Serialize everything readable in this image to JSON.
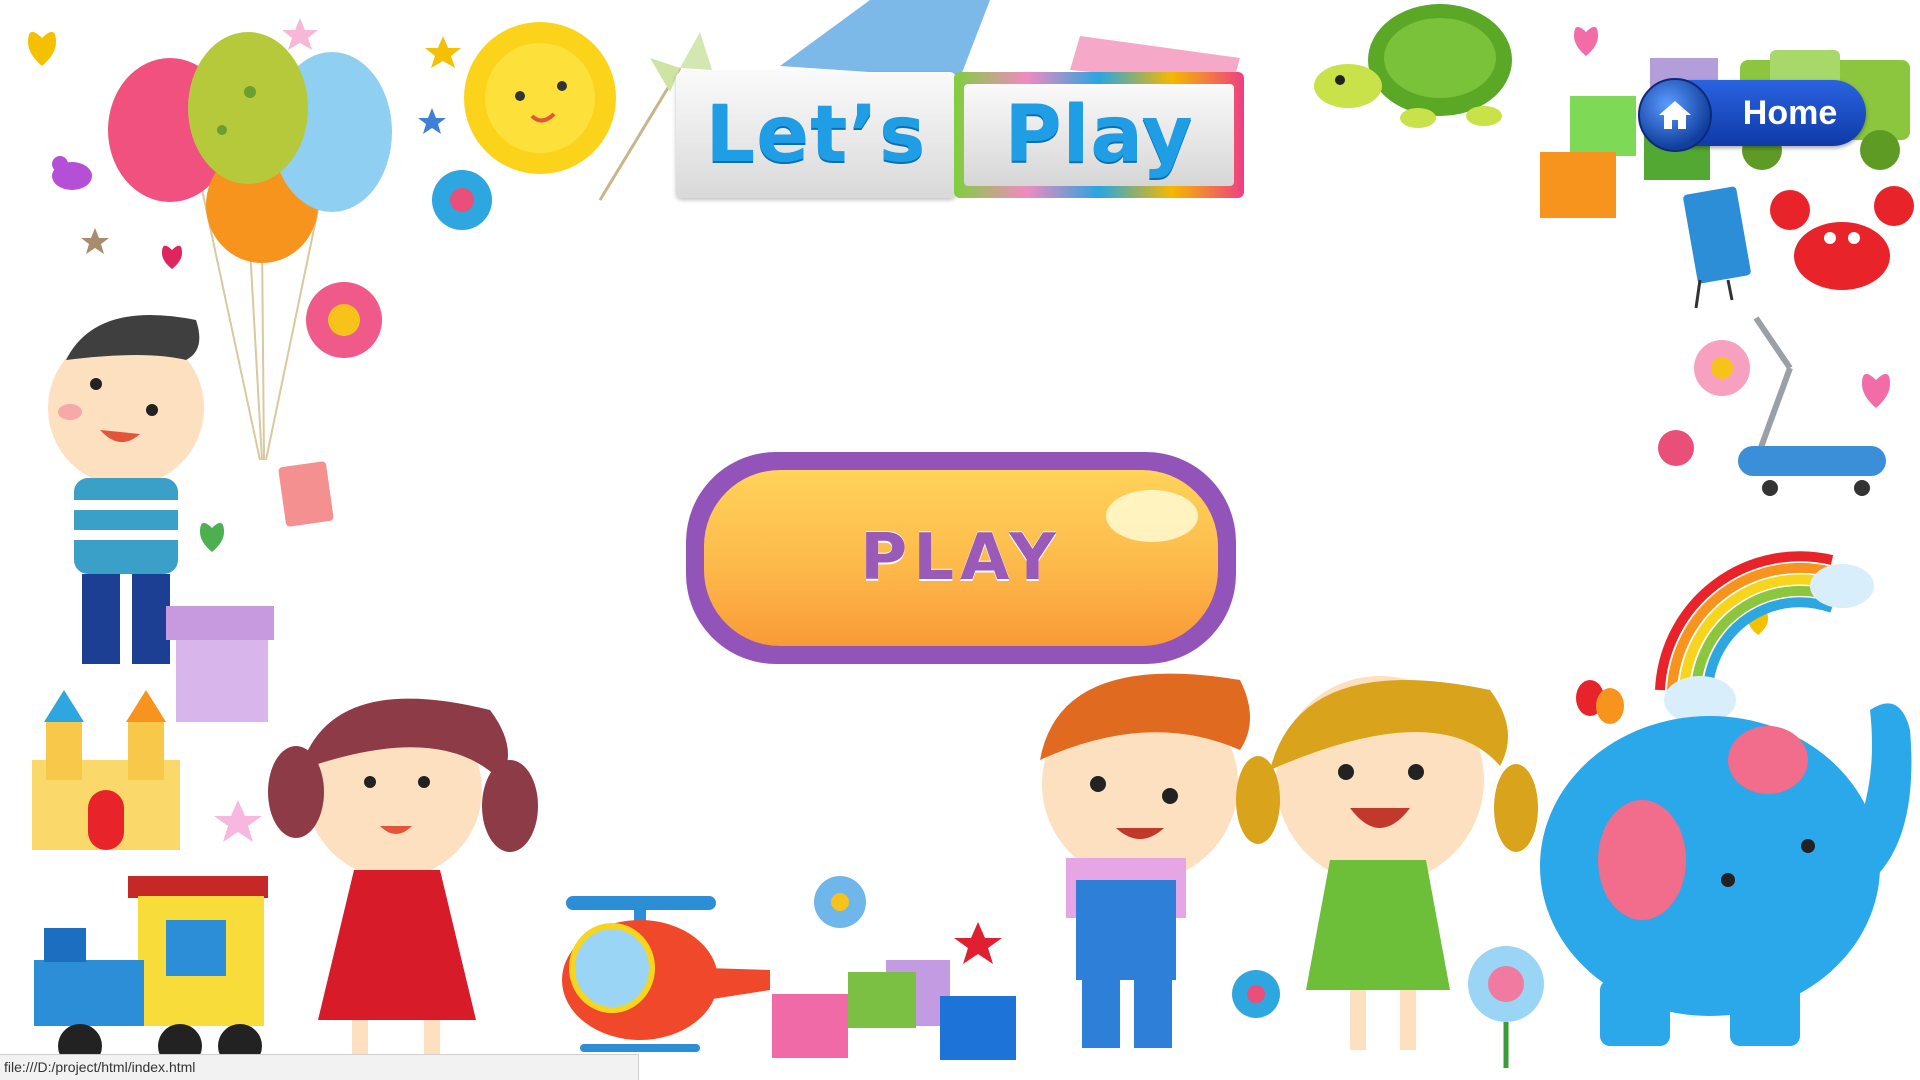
{
  "title": {
    "word1": "Let’s",
    "word2": "Play"
  },
  "home_button": {
    "label": "Home",
    "icon": "home-icon"
  },
  "play_button": {
    "label": "PLAY"
  },
  "status_bar": {
    "url": "file:///D:/project/html/index.html"
  },
  "colors": {
    "title_text": "#1f9ee6",
    "home_button": "#1a4fd0",
    "play_border": "#9254b8",
    "play_fill": "#fdb94a",
    "play_text": "#9a5ab8"
  },
  "decorations": [
    "balloons",
    "sun",
    "pinwheel",
    "book",
    "turtle",
    "toy-truck",
    "blocks",
    "crab",
    "walking-book",
    "scooter",
    "rainbow",
    "boy-with-balloons",
    "gift-box",
    "castle",
    "girl-red-dress",
    "train",
    "helicopter",
    "boy-overalls",
    "girl-green-dress",
    "flowers",
    "butterfly",
    "elephant",
    "hearts",
    "stars"
  ]
}
